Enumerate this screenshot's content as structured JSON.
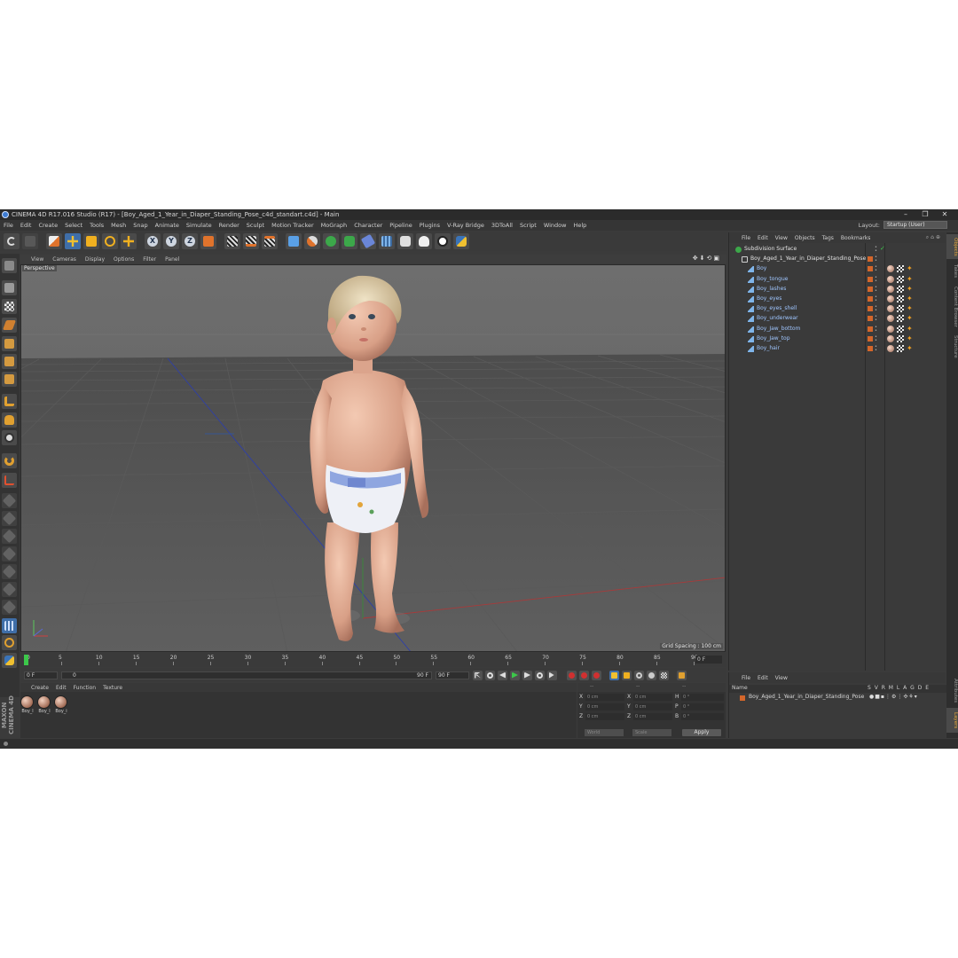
{
  "window": {
    "title": "CINEMA 4D R17.016 Studio (R17) - [Boy_Aged_1_Year_in_Diaper_Standing_Pose_c4d_standart.c4d] - Main",
    "controls": [
      "–",
      "❐",
      "✕"
    ]
  },
  "menubar": {
    "items": [
      "File",
      "Edit",
      "Create",
      "Select",
      "Tools",
      "Mesh",
      "Snap",
      "Animate",
      "Simulate",
      "Render",
      "Sculpt",
      "Motion Tracker",
      "MoGraph",
      "Character",
      "Pipeline",
      "Plugins",
      "V-Ray Bridge",
      "3DToAll",
      "Script",
      "Window",
      "Help"
    ],
    "layout_label": "Layout:",
    "layout_value": "Startup (User)"
  },
  "toolbar": {
    "axis": [
      "X",
      "Y",
      "Z"
    ]
  },
  "viewport": {
    "menu": [
      "View",
      "Cameras",
      "Display",
      "Options",
      "Filter",
      "Panel"
    ],
    "nav_icons": "✥⬇⟲▣",
    "camera_label": "Perspective",
    "grid_spacing": "Grid Spacing : 100 cm"
  },
  "timeline": {
    "ticks": [
      "0",
      "5",
      "10",
      "15",
      "20",
      "25",
      "30",
      "35",
      "40",
      "45",
      "50",
      "55",
      "60",
      "65",
      "70",
      "75",
      "80",
      "85",
      "90"
    ],
    "current_frame_display": "0 F",
    "start_field": "0 F",
    "range_start": "0",
    "range_end": "90 F",
    "end_field": "90 F"
  },
  "material_manager": {
    "menu": [
      "Create",
      "Edit",
      "Function",
      "Texture"
    ],
    "materials": [
      "Boy_l",
      "Boy_l",
      "Boy_i"
    ]
  },
  "coordinates": {
    "header": [
      "--",
      "--",
      "--"
    ],
    "rows": [
      {
        "a": "X",
        "av": "0 cm",
        "b": "X",
        "bv": "0 cm",
        "c": "H",
        "cv": "0 °"
      },
      {
        "a": "Y",
        "av": "0 cm",
        "b": "Y",
        "bv": "0 cm",
        "c": "P",
        "cv": "0 °"
      },
      {
        "a": "Z",
        "av": "0 cm",
        "b": "Z",
        "bv": "0 cm",
        "c": "B",
        "cv": "0 °"
      }
    ],
    "mode": "World",
    "scale_mode": "Scale",
    "apply": "Apply"
  },
  "objects_panel": {
    "menu": [
      "File",
      "Edit",
      "View",
      "Objects",
      "Tags",
      "Bookmarks"
    ],
    "objects": [
      {
        "name": "Subdivision Surface",
        "indent": 0,
        "tags": false
      },
      {
        "name": "Boy_Aged_1_Year_in_Diaper_Standing_Pose",
        "indent": 1,
        "tags": false
      },
      {
        "name": "Boy",
        "indent": 2,
        "tags": true
      },
      {
        "name": "Boy_tongue",
        "indent": 2,
        "tags": true
      },
      {
        "name": "Boy_lashes",
        "indent": 2,
        "tags": true
      },
      {
        "name": "Boy_eyes",
        "indent": 2,
        "tags": true
      },
      {
        "name": "Boy_eyes_shell",
        "indent": 2,
        "tags": true
      },
      {
        "name": "Boy_underwear",
        "indent": 2,
        "tags": true
      },
      {
        "name": "Boy_Jaw_bottom",
        "indent": 2,
        "tags": true
      },
      {
        "name": "Boy_Jaw_top",
        "indent": 2,
        "tags": true
      },
      {
        "name": "Boy_hair",
        "indent": 2,
        "tags": true
      }
    ]
  },
  "layer_panel": {
    "menu": [
      "File",
      "Edit",
      "View"
    ],
    "header_name": "Name",
    "header_cols": "S V R M L A G D E",
    "row_name": "Boy_Aged_1_Year_in_Diaper_Standing_Pose"
  },
  "side_tabs": [
    "Objects",
    "Takes",
    "Content Browser",
    "Structure",
    "Attributes",
    "Layers"
  ],
  "colors": {
    "layer_orange": "#d4662a",
    "object_blue": "#9fc6ff",
    "ground_grid": "#505050",
    "accent_orange": "#e8a83a"
  }
}
